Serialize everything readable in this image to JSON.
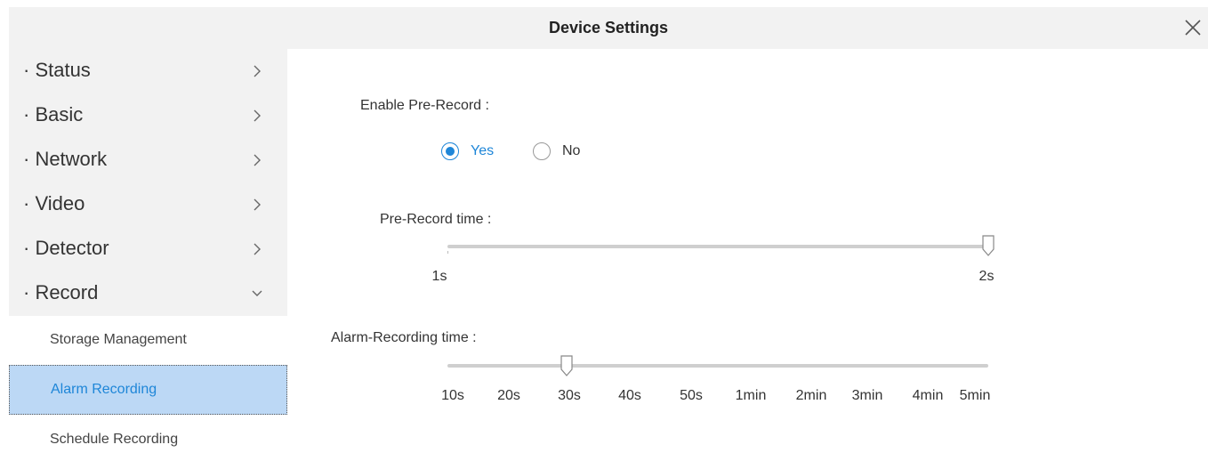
{
  "header": {
    "title": "Device Settings"
  },
  "sidebar": {
    "menu": [
      {
        "label": "· Status"
      },
      {
        "label": "· Basic"
      },
      {
        "label": "· Network"
      },
      {
        "label": "· Video"
      },
      {
        "label": "· Detector"
      },
      {
        "label": "· Record"
      }
    ],
    "submenu": [
      {
        "label": "Storage Management"
      },
      {
        "label": "Alarm Recording",
        "active": true
      },
      {
        "label": "Schedule Recording"
      }
    ]
  },
  "form": {
    "pre_record_label": "Enable Pre-Record :",
    "pre_record_options": {
      "yes": "Yes",
      "no": "No",
      "selected": "Yes"
    },
    "pre_record_time_label": "Pre-Record time :",
    "pre_record_time_ticks": [
      "1s",
      "2s"
    ],
    "pre_record_time_value": "2s",
    "alarm_time_label": "Alarm-Recording time :",
    "alarm_time_ticks": [
      "10s",
      "20s",
      "30s",
      "40s",
      "50s",
      "1min",
      "2min",
      "3min",
      "4min",
      "5min"
    ],
    "alarm_time_value": "30s"
  },
  "colors": {
    "accent": "#1e86d8",
    "panel": "#f2f2f2",
    "active_bg": "#bcd8f5"
  }
}
